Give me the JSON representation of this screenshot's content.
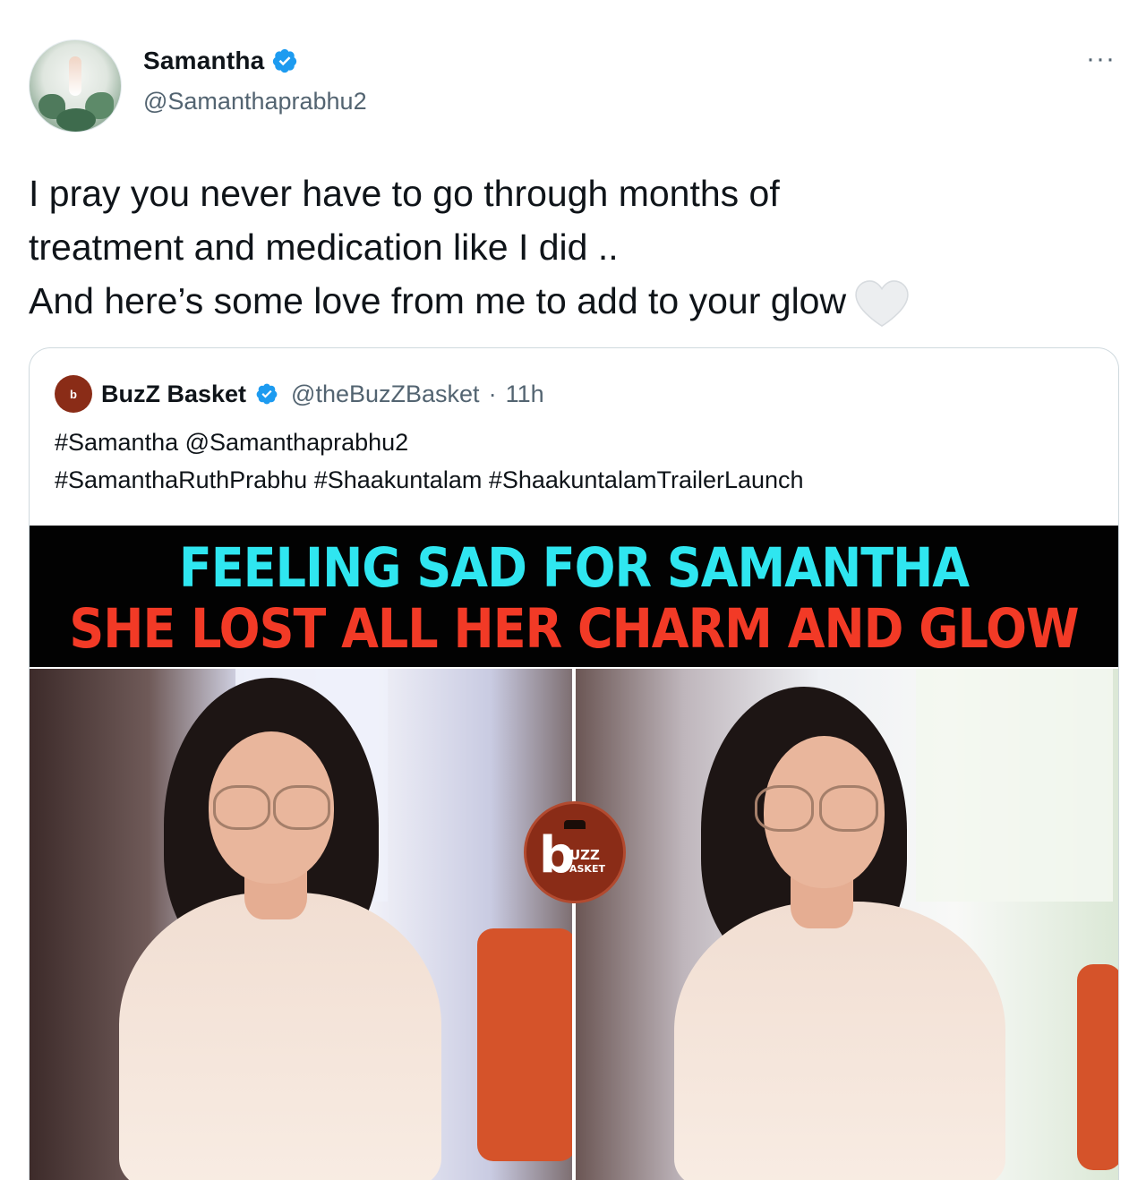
{
  "tweet": {
    "author_name": "Samantha",
    "author_handle": "@Samanthaprabhu2",
    "more_label": "···",
    "text_lines": [
      "I pray you never have to go through months of",
      "treatment and medication like I did ..",
      "And here’s some love from me to add to your glow"
    ],
    "emoji_icon": "white-heart-icon"
  },
  "quoted": {
    "author_name": "BuzZ Basket",
    "author_handle": "@theBuzZBasket",
    "separator": "·",
    "time": "11h",
    "tag_lines": [
      "#Samantha @Samanthaprabhu2",
      "#SamanthaRuthPrabhu #Shaakuntalam #ShaakuntalamTrailerLaunch"
    ],
    "media": {
      "headline_1": "FEELING SAD FOR SAMANTHA",
      "headline_2": "SHE LOST ALL HER CHARM AND GLOW",
      "headline_1_color": "#2fe6f0",
      "headline_2_color": "#f23a26",
      "watermark_letter": "b",
      "watermark_text_1": "UZZ",
      "watermark_text_2": "ASKET"
    }
  },
  "colors": {
    "verified": "#1d9bf0",
    "secondary_text": "#536471",
    "brand_badge": "#8a2c17"
  }
}
